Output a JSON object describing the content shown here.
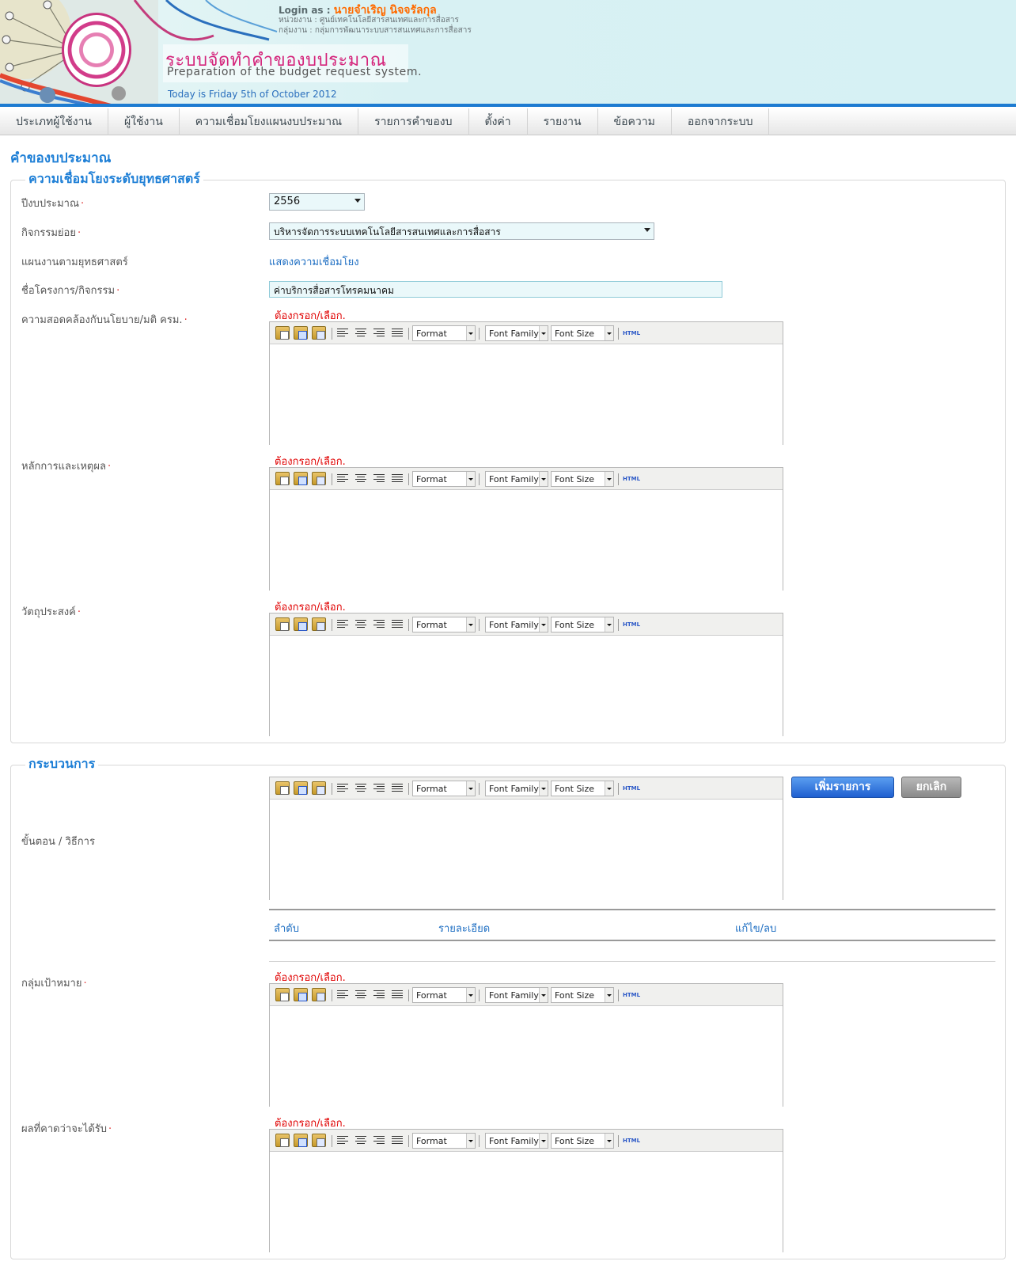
{
  "header": {
    "login_prefix": "Login as :",
    "login_user": "นายจำเริญ นิจจรัลกุล",
    "unit": "หน่วยงาน : ศูนย์เทคโนโลยีสารสนเทศและการสื่อสาร",
    "group": "กลุ่มงาน : กลุ่มการพัฒนาระบบสารสนเทศและการสื่อสาร",
    "system_title": "ระบบจัดทำคำของบประมาณ",
    "system_subtitle": "Preparation of the budget request system.",
    "today": "Today is Friday 5th of October 2012"
  },
  "nav": {
    "items": [
      "ประเภทผู้ใช้งาน",
      "ผู้ใช้งาน",
      "ความเชื่อมโยงแผนงบประมาณ",
      "รายการคำของบ",
      "ตั้งค่า",
      "รายงาน",
      "ข้อความ",
      "ออกจากระบบ"
    ]
  },
  "page": {
    "title": "คำของบประมาณ"
  },
  "strategy": {
    "legend": "ความเชื่อมโยงระดับยุทธศาสตร์",
    "fields": {
      "budget_year": {
        "label": "ปีงบประมาณ",
        "value": "2556"
      },
      "sub_activity": {
        "label": "กิจกรรมย่อย",
        "value": "บริหารจัดการระบบเทคโนโลยีสารสนเทศและการสื่อสาร"
      },
      "strategic_plan": {
        "label": "แผนงานตามยุทธศาสตร์",
        "link": "แสดงความเชื่อมโยง"
      },
      "project_name": {
        "label": "ชื่อโครงการ/กิจกรรม",
        "value": "ค่าบริการสื่อสารโทรคมนาคม"
      },
      "policy_alignment": {
        "label": "ความสอดคล้องกับนโยบาย/มติ ครม."
      },
      "rationale": {
        "label": "หลักการและเหตุผล"
      },
      "objective": {
        "label": "วัตถุประสงค์"
      }
    }
  },
  "process": {
    "legend": "กระบวนการ",
    "steps_label": "ขั้นตอน / วิธีการ",
    "add_button": "เพิ่มรายการ",
    "cancel_button": "ยกเลิก",
    "table_headers": {
      "order": "ลำดับ",
      "detail": "รายละเอียด",
      "edit_delete": "แก้ไข/ลบ"
    },
    "target_group": {
      "label": "กลุ่มเป้าหมาย"
    },
    "expected_result": {
      "label": "ผลที่คาดว่าจะได้รับ"
    }
  },
  "required_mark": "·",
  "required_message": "ต้องกรอก/เลือก.",
  "editor_toolbar": {
    "format": "Format",
    "font_family": "Font Family",
    "font_size": "Font Size",
    "html": "HTML"
  },
  "colors": {
    "accent_blue": "#1e7fd6",
    "brand_pink": "#d4237a",
    "required_red": "#e00000",
    "login_orange": "#ff6b00"
  }
}
